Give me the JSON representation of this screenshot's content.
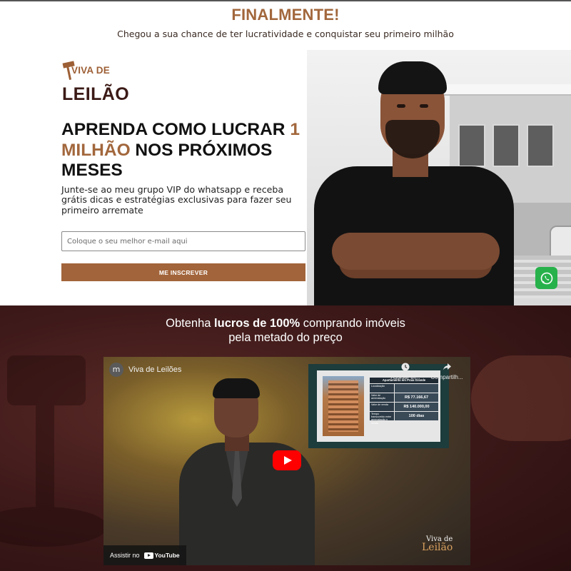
{
  "top_banner": {
    "title": "FINALMENTE!",
    "subtitle": "Chegou a sua chance de ter lucratividade e conquistar seu primeiro milhão"
  },
  "logo": {
    "line1": "VIVA DE",
    "line2": "LEILÃO"
  },
  "hero": {
    "headline_part1": "APRENDA COMO LUCRAR ",
    "headline_accent": "1 MILHÃO",
    "headline_part2": " NOS PRÓXIMOS MESES",
    "description": "Junte-se ao meu grupo VIP do whatsapp e receba grátis dicas e estratégias exclusivas para fazer seu primeiro arremate",
    "email_placeholder": "Coloque o seu melhor e-mail aqui",
    "email_value": "",
    "cta_label": "ME INSCREVER"
  },
  "whatsapp": {
    "icon": "whatsapp-icon",
    "color": "#27b14b"
  },
  "section2": {
    "title_part1": "Obtenha ",
    "title_bold": "lucros de 100%",
    "title_part2": " comprando imóveis",
    "title_line2": "pela metado do preço"
  },
  "video": {
    "channel_initial": "m",
    "title": "Viva de Leilões",
    "watch_later_label": "Assistir m...",
    "share_label": "Compartilh...",
    "watch_on_label": "Assistir no",
    "youtube_label": "YouTube",
    "logo_line1": "Viva de",
    "logo_line2": "Leilão",
    "table": {
      "header": "Apartamento em Praia Grande",
      "rows": [
        {
          "key": "Localização",
          "value": ""
        },
        {
          "key": "Valor de arrematação",
          "value": "R$ 77.166,67"
        },
        {
          "key": "Valor de venda",
          "value": "R$ 140.000,00"
        },
        {
          "key": "Tempo transcorrido entre arrematação e venda",
          "value": "100 dias"
        }
      ]
    }
  },
  "colors": {
    "accent": "#a2673c",
    "dark_bg": "#3f1a1a",
    "cta_bg": "#a2643a",
    "youtube_red": "#ff0000"
  }
}
